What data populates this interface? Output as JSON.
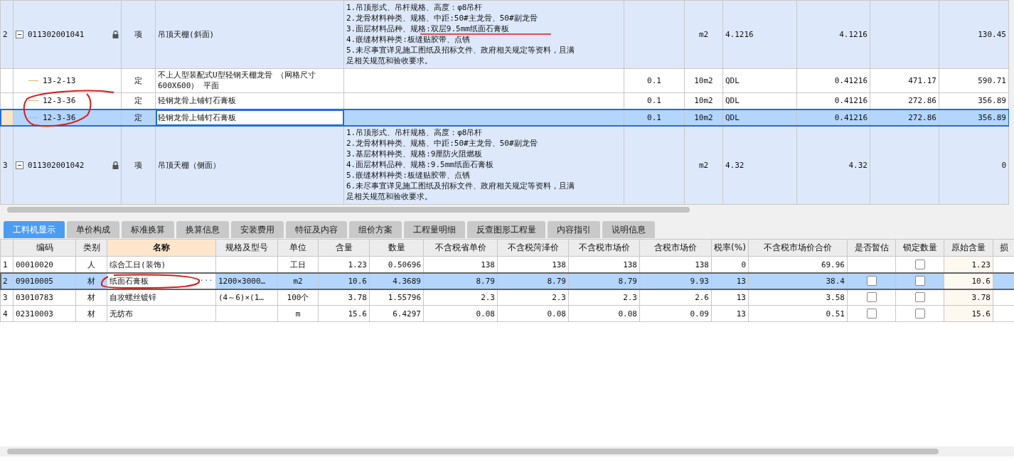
{
  "items_table": {
    "rows": [
      {
        "num": "2",
        "code": "011302001041",
        "expanded": true,
        "locked": true,
        "type": "项",
        "name": "吊顶天棚(斜面)",
        "features": [
          "1.吊顶形式、吊杆规格、高度：φ8吊杆",
          "2.龙骨材料种类、规格、中距:50#主龙骨、50#副龙骨",
          "3.面层材料品种、规格:双层9.5mm纸面石膏板",
          "4.嵌缝材料种类:板缝贴胶带、点锈",
          "5.未尽事宜详见施工图纸及招标文件、政府相关规定等资料，且满",
          "足相关规范和验收要求。"
        ],
        "unit": "m2",
        "qty_expr": "4.1216",
        "qty": "4.1216",
        "total": "130.45",
        "selected": false,
        "children": [
          {
            "code": "13-2-13",
            "type": "定",
            "name": "不上人型装配式U型轻钢天棚龙骨 （网格尺寸600X600） 平面",
            "column_6": "0.1",
            "unit": "10m2",
            "qty_expr": "QDL",
            "qty": "0.41216",
            "price": "471.17",
            "total": "590.71",
            "selected": false
          },
          {
            "code": "12-3-36",
            "type": "定",
            "name": "轻钢龙骨上铺钉石膏板",
            "column_6": "0.1",
            "unit": "10m2",
            "qty_expr": "QDL",
            "qty": "0.41216",
            "price": "272.86",
            "total": "356.89",
            "selected": false
          },
          {
            "code": "12-3-36",
            "type": "定",
            "name": "轻钢龙骨上铺钉石膏板",
            "column_6": "0.1",
            "unit": "10m2",
            "qty_expr": "QDL",
            "qty": "0.41216",
            "price": "272.86",
            "total": "356.89",
            "selected": true
          }
        ]
      },
      {
        "num": "3",
        "code": "011302001042",
        "expanded": true,
        "locked": true,
        "type": "项",
        "name": "吊顶天棚（侧面）",
        "features": [
          "1.吊顶形式、吊杆规格、高度：φ8吊杆",
          "2.龙骨材料种类、规格、中距:50#主龙骨、50#副龙骨",
          "3.基层材料种类、规格:9厘防火阻燃板",
          "4.面层材料品种、规格:9.5mm纸面石膏板",
          "5.嵌缝材料种类:板缝贴胶带、点锈",
          "6.未尽事宜详见施工图纸及招标文件、政府相关规定等资料，且满",
          "足相关规范和验收要求。"
        ],
        "unit": "m2",
        "qty_expr": "4.32",
        "qty": "4.32",
        "total": "0",
        "selected": false,
        "children": []
      }
    ]
  },
  "tabs": [
    {
      "label": "工料机显示",
      "selected": true
    },
    {
      "label": "单价构成",
      "selected": false
    },
    {
      "label": "标准换算",
      "selected": false
    },
    {
      "label": "换算信息",
      "selected": false
    },
    {
      "label": "安装费用",
      "selected": false
    },
    {
      "label": "特征及内容",
      "selected": false
    },
    {
      "label": "组价方案",
      "selected": false
    },
    {
      "label": "工程量明细",
      "selected": false
    },
    {
      "label": "反查图形工程量",
      "selected": false
    },
    {
      "label": "内容指引",
      "selected": false
    },
    {
      "label": "说明信息",
      "selected": false
    }
  ],
  "resources_table": {
    "columns": [
      "编码",
      "类别",
      "名称",
      "规格及型号",
      "单位",
      "含量",
      "数量",
      "不含税省单价",
      "不含税菏泽价",
      "不含税市场价",
      "含税市场价",
      "税率(%)",
      "不含税市场价合价",
      "是否暂估",
      "锁定数量",
      "原始含量",
      "损"
    ],
    "rows": [
      {
        "num": "1",
        "code": "00010020",
        "type": "人",
        "name": "综合工日(装饰)",
        "unit": "工日",
        "content": "1.23",
        "qty": "0.50696",
        "prov_price": "138",
        "heze_price": "138",
        "market_price": "138",
        "tax_market_price": "138",
        "tax_rate": "0",
        "market_total": "69.96",
        "lock_qty": {
          "checked": false
        },
        "orig_content": "1.23",
        "selected": false
      },
      {
        "num": "2",
        "code": "09010005",
        "type": "材",
        "name": "纸面石膏板",
        "edit_button": "···",
        "spec": "1200×3000…",
        "unit": "m2",
        "content": "10.6",
        "qty": "4.3689",
        "prov_price": "8.79",
        "heze_price": "8.79",
        "market_price": "8.79",
        "tax_market_price": "9.93",
        "tax_rate": "13",
        "market_total": "38.4",
        "provisional": {
          "checked": false
        },
        "lock_qty": {
          "checked": false
        },
        "orig_content": "10.6",
        "selected": true
      },
      {
        "num": "3",
        "code": "03010783",
        "type": "材",
        "name": "自攻螺丝镀锌",
        "spec": "(4～6)×(1…",
        "unit": "100个",
        "content": "3.78",
        "qty": "1.55796",
        "prov_price": "2.3",
        "heze_price": "2.3",
        "market_price": "2.3",
        "tax_market_price": "2.6",
        "tax_rate": "13",
        "market_total": "3.58",
        "provisional": {
          "checked": false
        },
        "lock_qty": {
          "checked": false
        },
        "orig_content": "3.78",
        "selected": false
      },
      {
        "num": "4",
        "code": "02310003",
        "type": "材",
        "name": "无纺布",
        "unit": "m",
        "content": "15.6",
        "qty": "6.4297",
        "prov_price": "0.08",
        "heze_price": "0.08",
        "market_price": "0.08",
        "tax_market_price": "0.09",
        "tax_rate": "13",
        "market_total": "0.51",
        "provisional": {
          "checked": false
        },
        "lock_qty": {
          "checked": false
        },
        "orig_content": "15.6",
        "selected": false
      }
    ]
  }
}
